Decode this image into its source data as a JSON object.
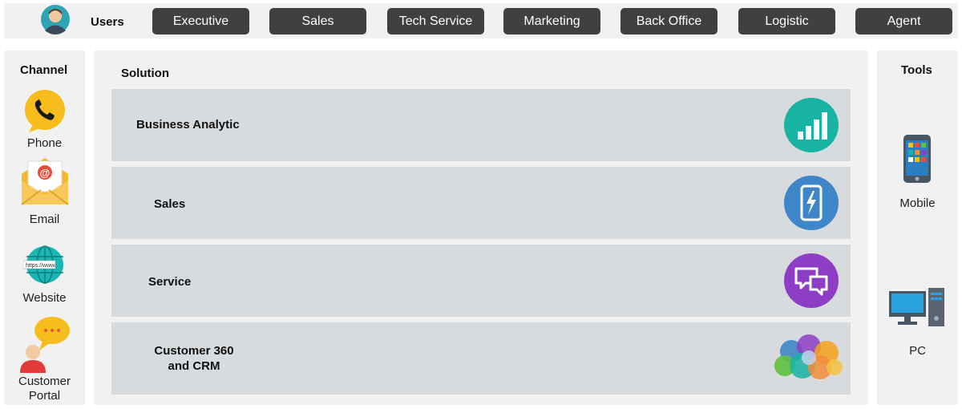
{
  "users": {
    "label": "Users",
    "avatar_icon": "user-avatar-icon",
    "roles": [
      "Executive",
      "Sales",
      "Tech Service",
      "Marketing",
      "Back Office",
      "Logistic",
      "Agent"
    ]
  },
  "channel": {
    "title": "Channel",
    "items": [
      {
        "label": "Phone",
        "icon": "phone-icon"
      },
      {
        "label": "Email",
        "icon": "email-icon"
      },
      {
        "label": "Website",
        "icon": "globe-icon"
      },
      {
        "label": "Customer Portal",
        "icon": "customer-portal-icon"
      }
    ]
  },
  "solution": {
    "title": "Solution",
    "rows": [
      {
        "label": "Business Analytic",
        "icon": "bar-chart-icon",
        "color": "#17b3a3"
      },
      {
        "label": "Sales",
        "icon": "mobile-lightning-icon",
        "color": "#3f86c8"
      },
      {
        "label": "Service",
        "icon": "chat-bubbles-icon",
        "color": "#8e3ec4"
      },
      {
        "label_line1": "Customer 360",
        "label_line2": "and CRM",
        "icon": "crm-cloud-icon"
      }
    ]
  },
  "tools": {
    "title": "Tools",
    "items": [
      {
        "label": "Mobile",
        "icon": "smartphone-icon"
      },
      {
        "label": "PC",
        "icon": "desktop-pc-icon"
      }
    ]
  },
  "colors": {
    "role_button_bg": "#404040",
    "panel_bg": "#f1f1f1",
    "row_bg": "#d7dbde"
  }
}
